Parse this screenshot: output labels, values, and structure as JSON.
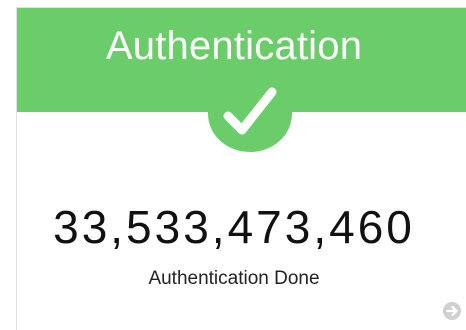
{
  "card": {
    "title": "Authentication",
    "count": "33,533,473,460",
    "label": "Authentication Done",
    "accent_color": "#6acd6a",
    "status_icon": "checkmark-icon",
    "more_icon": "arrow-right-circle-icon"
  }
}
